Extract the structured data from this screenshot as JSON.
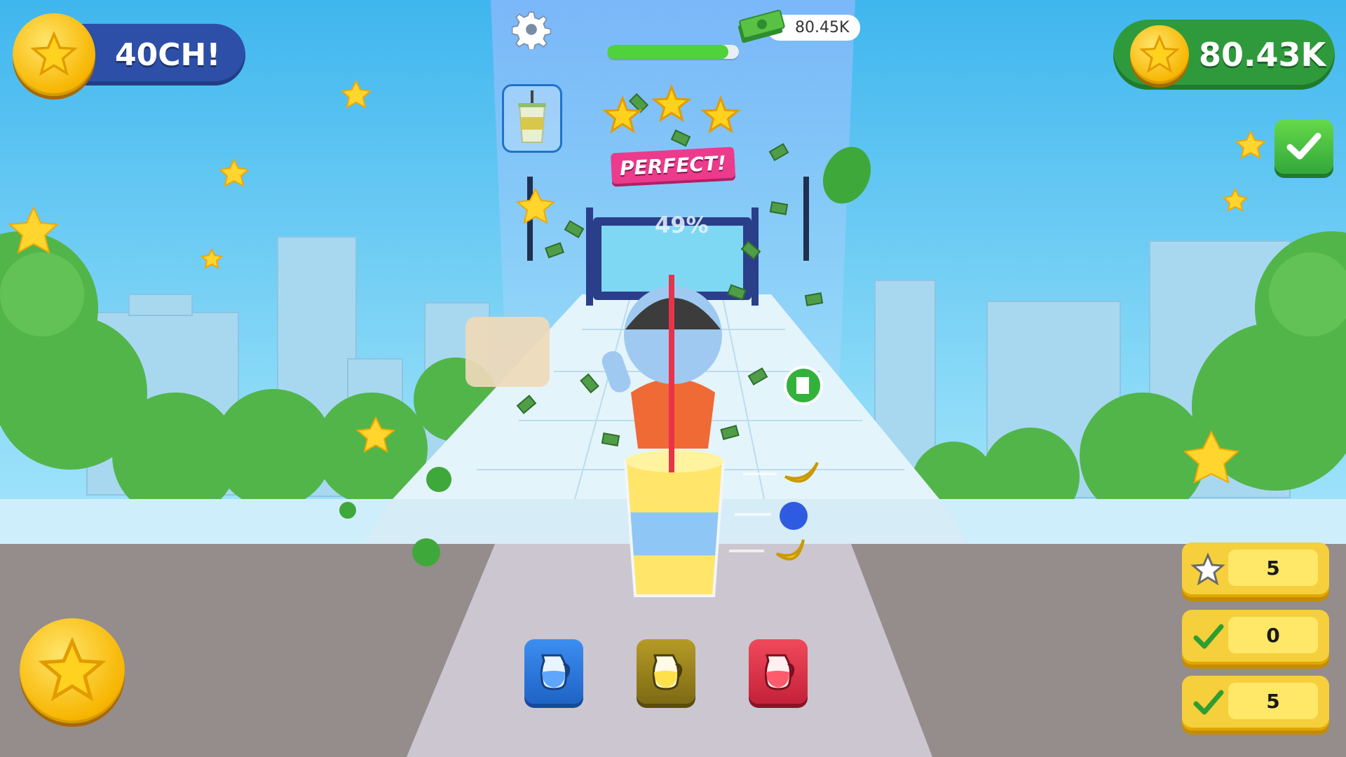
{
  "hud": {
    "left_counter": {
      "value": "40CH!",
      "icon": "star-coin-icon"
    },
    "right_counter": {
      "value": "80.43K",
      "icon": "star-coin-icon"
    },
    "money": {
      "value": "80.45K",
      "icon": "cash-stack-icon"
    },
    "settings_icon": "gear-icon"
  },
  "progress": {
    "fraction": 0.92,
    "percent_text": "49%"
  },
  "rating": {
    "stars": 3,
    "label": "PERFECT!"
  },
  "target_drink_icon": "juice-cup-icon",
  "confirm_icon": "checkmark-icon",
  "side_panels": [
    {
      "icon": "star-outline-icon",
      "value": "5"
    },
    {
      "icon": "checkmark-icon",
      "value": "0"
    },
    {
      "icon": "checkmark-icon",
      "value": "5"
    }
  ],
  "jugs": [
    {
      "name": "blue-jug",
      "color": "#3b8ef0",
      "liquid": "#5fa6ff"
    },
    {
      "name": "yellow-jug",
      "color": "#b59b26",
      "liquid": "#ffe04a"
    },
    {
      "name": "red-jug",
      "color": "#f0495a",
      "liquid": "#ff5b6c"
    }
  ],
  "colors": {
    "sky": "#5ec8f2",
    "accent_green": "#2f9a3c",
    "accent_blue": "#2d4fa8",
    "coin": "#f7b500",
    "perfect": "#ec3b8c"
  }
}
